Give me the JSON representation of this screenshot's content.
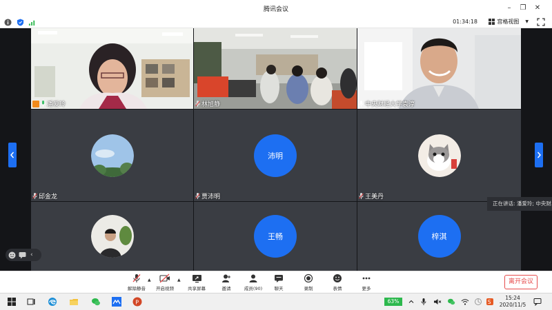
{
  "window": {
    "title": "腾讯会议"
  },
  "infobar": {
    "timer": "01:34:18",
    "view_mode": "宫格视图"
  },
  "participants": [
    {
      "name": "潘爱玲",
      "type": "video",
      "scene": "office-wall"
    },
    {
      "name": "林旭静",
      "type": "video",
      "scene": "classroom"
    },
    {
      "name": "中央财经大学袁淳",
      "type": "video",
      "scene": "bright-room"
    },
    {
      "name": "邱金龙",
      "type": "avatar",
      "avatar_icon": "sky-trees-avatar"
    },
    {
      "name": "贾沛明",
      "type": "initials",
      "initials": "沛明"
    },
    {
      "name": "王美丹",
      "type": "avatar",
      "avatar_icon": "kitten-avatar"
    },
    {
      "name": "",
      "type": "avatar",
      "avatar_icon": "person-photo-avatar"
    },
    {
      "name": "",
      "type": "initials",
      "initials": "王畅"
    },
    {
      "name": "",
      "type": "initials",
      "initials": "梓淇"
    }
  ],
  "speaking_indicator": "正在讲话: 潘爱玲; 中央财...",
  "toolbar": {
    "unmute": "解除静音",
    "start_video": "开启视频",
    "share_screen": "共享屏幕",
    "invite": "邀请",
    "members": "成员(90)",
    "chat": "聊天",
    "record": "录制",
    "reactions": "表情",
    "more": "更多",
    "leave": "离开会议"
  },
  "taskbar": {
    "battery": "63%",
    "time": "15:24",
    "date": "2020/11/5"
  },
  "colors": {
    "accent": "#1d6ff2",
    "tile_bg": "#3a3d43",
    "leave_red": "#e64b4b",
    "battery_green": "#2db84d"
  }
}
